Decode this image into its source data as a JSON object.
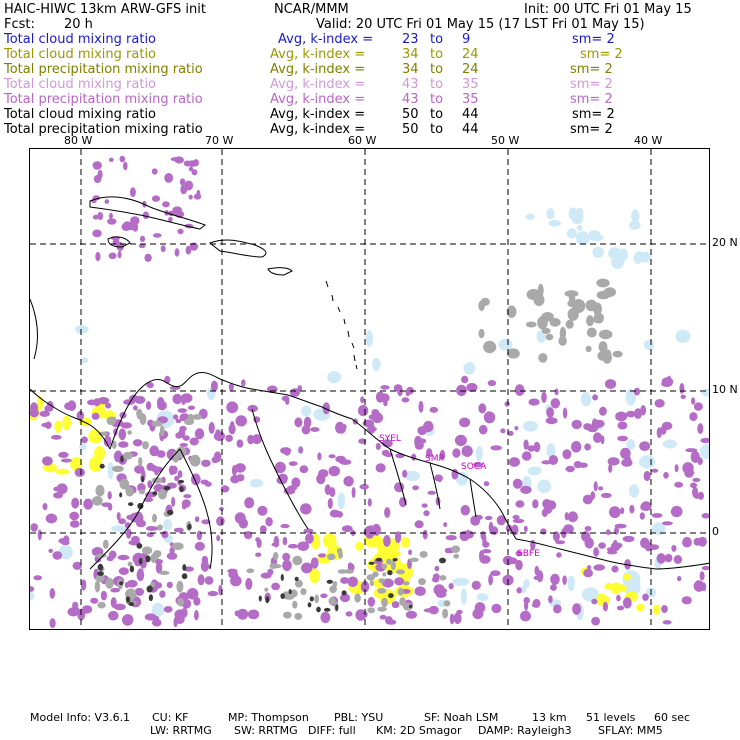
{
  "header": {
    "model_title": "HAIC-HIWC 13km ARW-GFS init",
    "org": "NCAR/MMM",
    "init": "Init: 00 UTC Fri 01 May 15",
    "fcst_label": "Fcst:",
    "fcst_value": "20 h",
    "valid": "Valid: 20 UTC Fri 01 May 15 (17 LST Fri 01 May 15)"
  },
  "fields": [
    {
      "name": "Total cloud mixing ratio",
      "avg": "Avg, k-index =",
      "k1": "23",
      "to": "to",
      "k2": "9",
      "sm": "sm= 2",
      "color": "#1a1acc"
    },
    {
      "name": "Total cloud mixing ratio",
      "avg": "Avg, k-index =",
      "k1": "34",
      "to": "to",
      "k2": "24",
      "sm": "sm= 2",
      "color": "#999900"
    },
    {
      "name": "Total precipitation mixing ratio",
      "avg": "Avg, k-index =",
      "k1": "34",
      "to": "to",
      "k2": "24",
      "sm": "sm= 2",
      "color": "#808000"
    },
    {
      "name": "Total cloud mixing ratio",
      "avg": "Avg, k-index =",
      "k1": "43",
      "to": "to",
      "k2": "35",
      "sm": "sm= 2",
      "color": "#d098d8"
    },
    {
      "name": "Total precipitation mixing ratio",
      "avg": "Avg, k-index =",
      "k1": "43",
      "to": "to",
      "k2": "35",
      "sm": "sm= 2",
      "color": "#b866c8"
    },
    {
      "name": "Total cloud mixing ratio",
      "avg": "Avg, k-index =",
      "k1": "50",
      "to": "to",
      "k2": "44",
      "sm": "sm= 2",
      "color": "#000000"
    },
    {
      "name": "Total precipitation mixing ratio",
      "avg": "Avg, k-index =",
      "k1": "50",
      "to": "to",
      "k2": "44",
      "sm": "sm= 2",
      "color": "#000000"
    }
  ],
  "map": {
    "lon_labels": [
      "80 W",
      "70 W",
      "60 W",
      "50 W",
      "40 W"
    ],
    "lat_labels": [
      "20 N",
      "10 N",
      "0"
    ],
    "stations": [
      "SYEL",
      "SMP",
      "SOCA",
      "SBFE"
    ],
    "colors": {
      "frame": "#000000",
      "grid": "#000000",
      "cloud_light": "#cfeaf6",
      "cloud_yellow": "#ffff33",
      "cloud_purple": "#b46cc6",
      "cloud_gray": "#a9a9a9",
      "cloud_dark": "#3a3a3a",
      "station": "#cc00cc"
    }
  },
  "footer": {
    "line1": [
      "Model Info: V3.6.1",
      "CU: KF",
      "MP: Thompson",
      "PBL: YSU",
      "SF: Noah LSM",
      "13 km",
      "51 levels",
      "60 sec"
    ],
    "line2": [
      "LW: RRTMG",
      "SW: RRTMG",
      "DIFF: full",
      "KM: 2D Smagor",
      "DAMP: Rayleigh3",
      "SFLAY: MM5"
    ]
  }
}
